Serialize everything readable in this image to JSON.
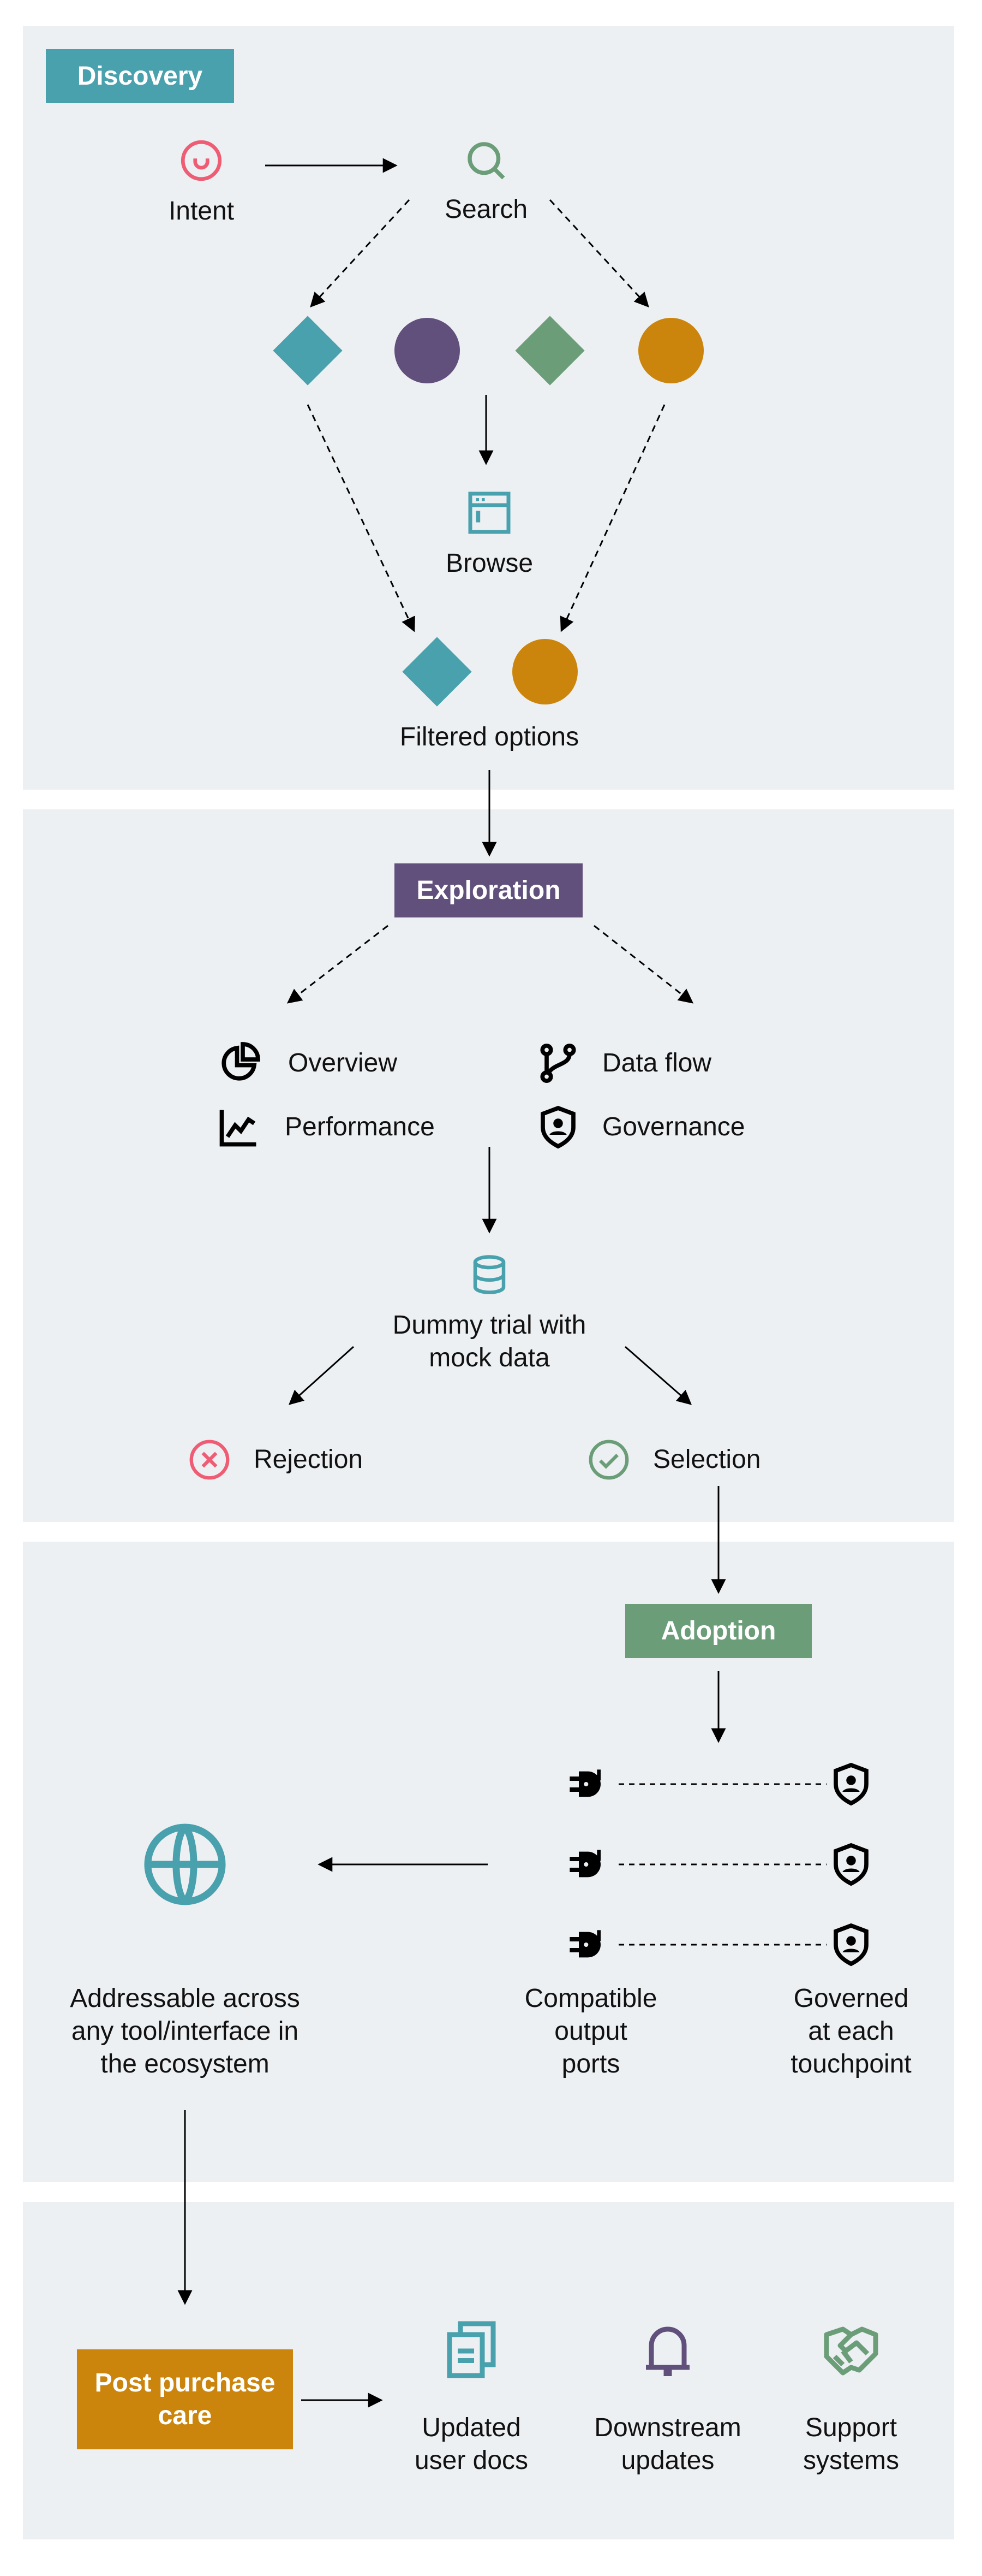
{
  "colors": {
    "teal": "#48a1ad",
    "purple": "#62507c",
    "green": "#6b9e78",
    "orange": "#cc850c",
    "pink": "#ef5d75",
    "panel": "#edf0f3"
  },
  "discovery": {
    "title": "Discovery",
    "intent": "Intent",
    "search": "Search",
    "browse": "Browse",
    "filtered": "Filtered options"
  },
  "exploration": {
    "title": "Exploration",
    "overview": "Overview",
    "performance": "Performance",
    "data_flow": "Data flow",
    "governance": "Governance",
    "trial_line1": "Dummy trial with",
    "trial_line2": "mock data",
    "rejection": "Rejection",
    "selection": "Selection"
  },
  "adoption": {
    "title": "Adoption",
    "addressable": [
      "Addressable across",
      "any tool/interface in",
      "the ecosystem"
    ],
    "ports": [
      "Compatible",
      "output",
      "ports"
    ],
    "governed": [
      "Governed",
      "at each",
      "touchpoint"
    ]
  },
  "post": {
    "title_line1": "Post purchase",
    "title_line2": "care",
    "docs": [
      "Updated",
      "user docs"
    ],
    "downstream": [
      "Downstream",
      "updates"
    ],
    "support": [
      "Support",
      "systems"
    ]
  }
}
